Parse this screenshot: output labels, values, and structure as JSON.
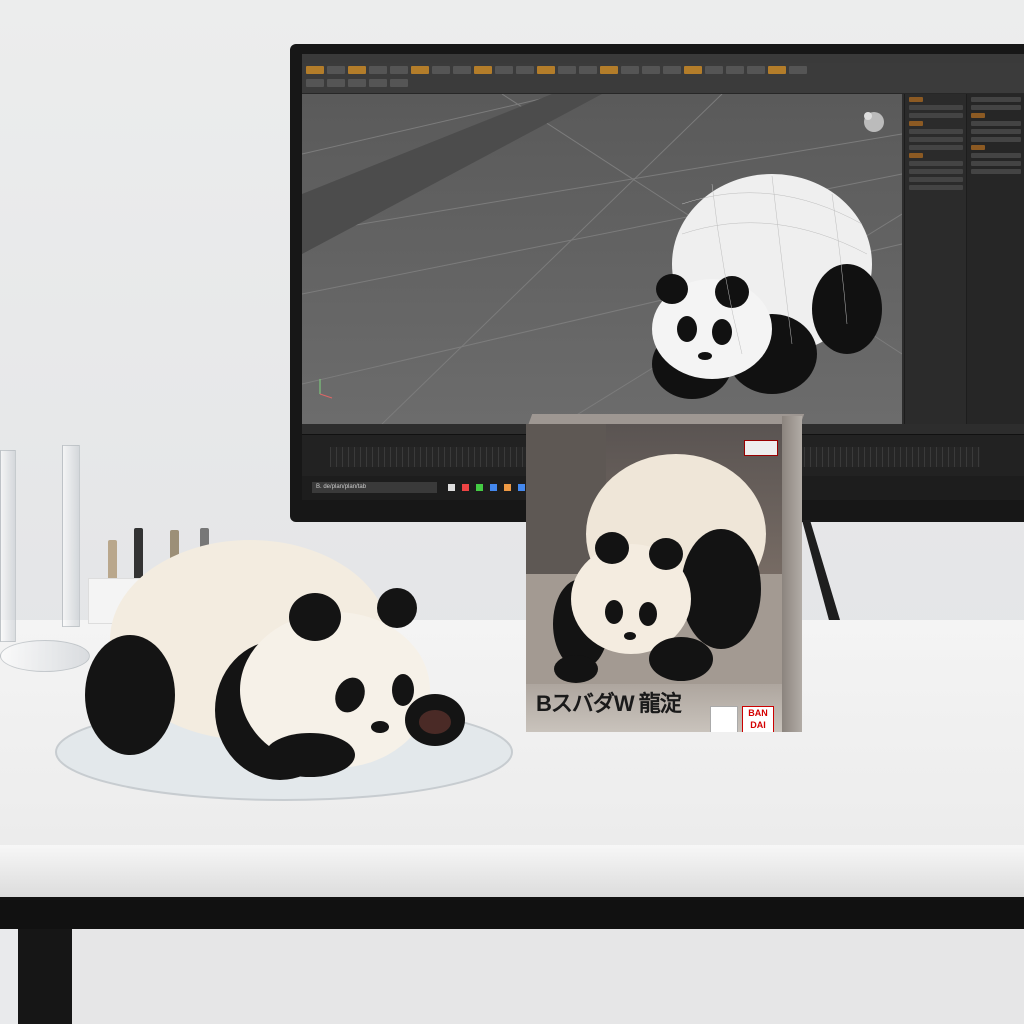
{
  "scene": {
    "description_free": true
  },
  "monitor": {
    "app": {
      "menu_text": "",
      "command_input": "B. de/plan/plan/tab",
      "accent_color": "#b37d2a"
    }
  },
  "box": {
    "title": "BスバダW 龍淀",
    "brand": "BAN DAI",
    "accent_color": "#d40000"
  },
  "colors": {
    "wall": "#e9eaec",
    "desk": "#f2f2f2",
    "desk_frame": "#111111",
    "panda_white": "#f3ece0",
    "panda_black": "#141414"
  }
}
